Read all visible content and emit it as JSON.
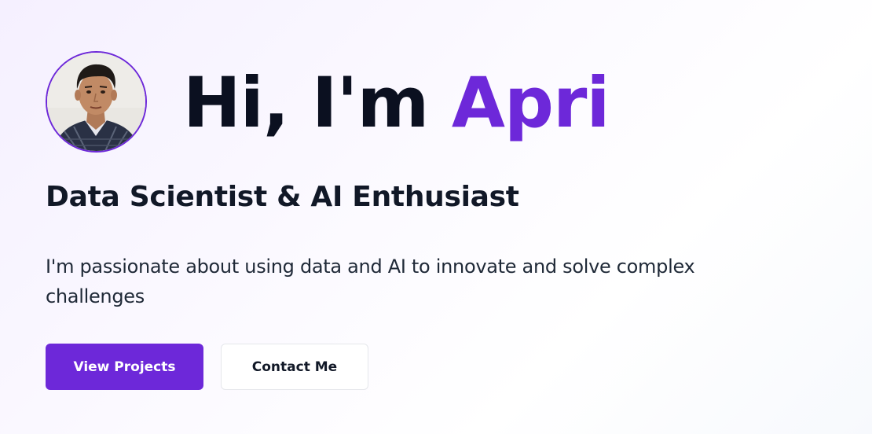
{
  "hero": {
    "greeting": "Hi, I'm ",
    "name": "Apri",
    "subtitle": "Data Scientist & AI Enthusiast",
    "description": "I'm passionate about using data and AI to innovate and solve complex challenges",
    "avatar_icon": "profile-photo"
  },
  "actions": {
    "primary_label": "View Projects",
    "secondary_label": "Contact Me"
  },
  "colors": {
    "accent": "#6d28d9",
    "heading": "#0b1020",
    "background": "#f7f4ff"
  }
}
